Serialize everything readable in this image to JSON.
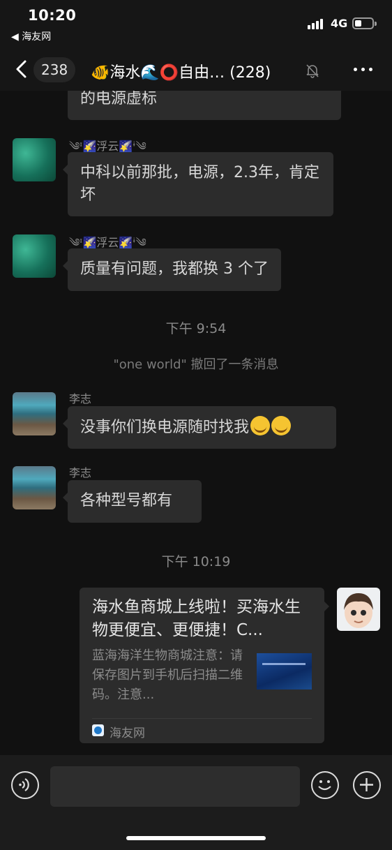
{
  "status_bar": {
    "time": "10:20",
    "back_app": "◀ 海友网",
    "network": "4G",
    "battery_level": 0.4
  },
  "nav": {
    "unread_count": "238",
    "title": "🐠海水🌊⭕自由… (228)",
    "icons": [
      "back-chevron-icon",
      "mute-bell-icon",
      "more-dots-icon"
    ]
  },
  "messages": {
    "m0_text": "的电源虚标",
    "m1_sender": "༄ᶦ🌠浮云🌠ᶤ༄",
    "m1_text": "中科以前那批，电源，2.3年，肯定坏",
    "m2_sender": "༄ᶦ🌠浮云🌠ᶤ༄",
    "m2_text": "质量有问题，我都换 3 个了",
    "time1": "下午 9:54",
    "recall": "\"one world\" 撤回了一条消息",
    "m3_sender": "李志",
    "m3_text": "没事你们换电源随时找我",
    "m4_sender": "李志",
    "m4_text": "各种型号都有",
    "time2": "下午 10:19"
  },
  "link_card": {
    "title": "海水鱼商城上线啦！买海水生物更便宜、更便捷！C...",
    "description": "蓝海海洋生物商城注意：请保存图片到手机后扫描二维码。注意...",
    "source": "海友网"
  },
  "input_bar": {
    "placeholder": "",
    "icons": [
      "voice-icon",
      "emoji-icon",
      "plus-icon"
    ]
  },
  "colors": {
    "background": "#111111",
    "bubble": "#2c2c2c",
    "text": "#d7d7d7"
  }
}
